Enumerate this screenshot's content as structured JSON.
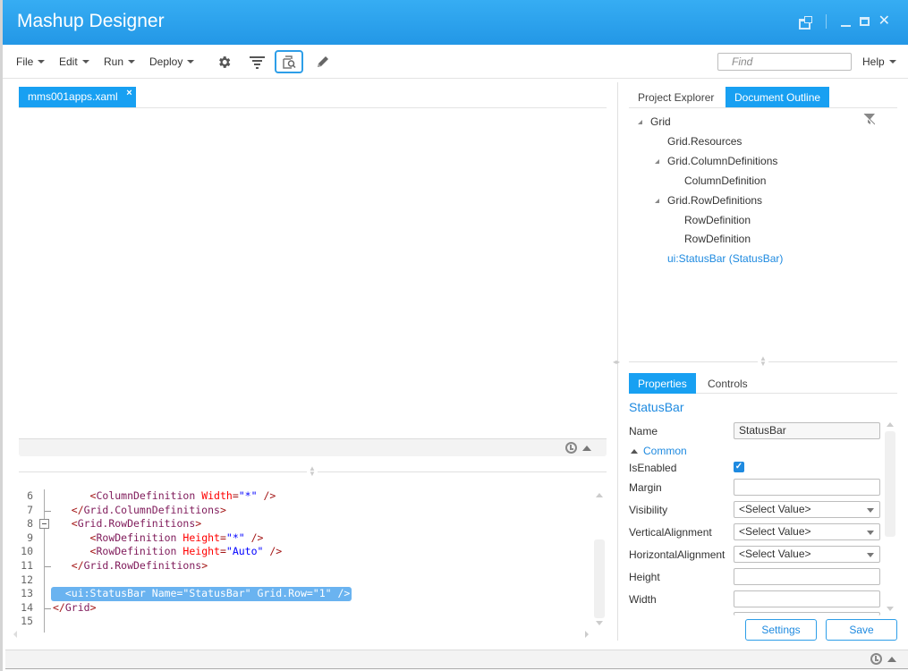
{
  "window": {
    "title": "Mashup Designer",
    "controls": [
      "restore-down",
      "minimize",
      "maximize",
      "close"
    ]
  },
  "toolbar": {
    "menus": [
      {
        "label": "File"
      },
      {
        "label": "Edit"
      },
      {
        "label": "Run"
      },
      {
        "label": "Deploy"
      }
    ],
    "tools": [
      {
        "icon": "gear-icon",
        "label": "Settings"
      },
      {
        "icon": "filter-icon",
        "label": "Filter"
      },
      {
        "icon": "preview-icon",
        "label": "Preview",
        "active": true
      },
      {
        "icon": "pencil-icon",
        "label": "Edit"
      }
    ],
    "find_placeholder": "Find",
    "help_label": "Help"
  },
  "editor": {
    "tabs": [
      {
        "label": "mms001apps.xaml",
        "close": "×"
      }
    ],
    "code_lines": [
      {
        "num": "6",
        "tokens": [
          {
            "t": "tag",
            "v": "      <"
          },
          {
            "t": "el",
            "v": "ColumnDefinition"
          },
          {
            "t": "",
            "v": " "
          },
          {
            "t": "attr",
            "v": "Width"
          },
          {
            "t": "tag",
            "v": "="
          },
          {
            "t": "val",
            "v": "\"*\""
          },
          {
            "t": "tag",
            "v": " />"
          }
        ]
      },
      {
        "num": "7",
        "tokens": [
          {
            "t": "tag",
            "v": "   </"
          },
          {
            "t": "el",
            "v": "Grid.ColumnDefinitions"
          },
          {
            "t": "tag",
            "v": ">"
          }
        ]
      },
      {
        "num": "8",
        "tokens": [
          {
            "t": "tag",
            "v": "   <"
          },
          {
            "t": "el",
            "v": "Grid.RowDefinitions"
          },
          {
            "t": "tag",
            "v": ">"
          }
        ]
      },
      {
        "num": "9",
        "tokens": [
          {
            "t": "tag",
            "v": "      <"
          },
          {
            "t": "el",
            "v": "RowDefinition"
          },
          {
            "t": "",
            "v": " "
          },
          {
            "t": "attr",
            "v": "Height"
          },
          {
            "t": "tag",
            "v": "="
          },
          {
            "t": "val",
            "v": "\"*\""
          },
          {
            "t": "tag",
            "v": " />"
          }
        ]
      },
      {
        "num": "10",
        "tokens": [
          {
            "t": "tag",
            "v": "      <"
          },
          {
            "t": "el",
            "v": "RowDefinition"
          },
          {
            "t": "",
            "v": " "
          },
          {
            "t": "attr",
            "v": "Height"
          },
          {
            "t": "tag",
            "v": "="
          },
          {
            "t": "val",
            "v": "\"Auto\""
          },
          {
            "t": "tag",
            "v": " />"
          }
        ]
      },
      {
        "num": "11",
        "tokens": [
          {
            "t": "tag",
            "v": "   </"
          },
          {
            "t": "el",
            "v": "Grid.RowDefinitions"
          },
          {
            "t": "tag",
            "v": ">"
          }
        ]
      },
      {
        "num": "12",
        "tokens": []
      },
      {
        "num": "13",
        "selected": true,
        "tokens": [
          {
            "t": "",
            "v": "  <ui:StatusBar Name=\"StatusBar\" Grid.Row=\"1\" />"
          }
        ]
      },
      {
        "num": "14",
        "tokens": [
          {
            "t": "tag",
            "v": "</"
          },
          {
            "t": "el",
            "v": "Grid"
          },
          {
            "t": "tag",
            "v": ">"
          }
        ]
      },
      {
        "num": "15",
        "tokens": []
      }
    ]
  },
  "right_panel": {
    "tabs": [
      {
        "label": "Project Explorer",
        "active": false
      },
      {
        "label": "Document Outline",
        "active": true
      }
    ],
    "outline": [
      {
        "label": "Grid",
        "level": 0,
        "expanded": true
      },
      {
        "label": "Grid.Resources",
        "level": 1
      },
      {
        "label": "Grid.ColumnDefinitions",
        "level": 1,
        "expanded": true
      },
      {
        "label": "ColumnDefinition",
        "level": 2
      },
      {
        "label": "Grid.RowDefinitions",
        "level": 1,
        "expanded": true
      },
      {
        "label": "RowDefinition",
        "level": 2
      },
      {
        "label": "RowDefinition",
        "level": 2
      },
      {
        "label": "ui:StatusBar (StatusBar)",
        "level": 1,
        "selected": true
      }
    ]
  },
  "properties": {
    "tabs": [
      {
        "label": "Properties",
        "active": true
      },
      {
        "label": "Controls",
        "active": false
      }
    ],
    "title": "StatusBar",
    "name_label": "Name",
    "name_value": "StatusBar",
    "section_label": "Common",
    "is_enabled_label": "IsEnabled",
    "is_enabled_checked": true,
    "rows": [
      {
        "label": "Margin",
        "type": "text",
        "value": ""
      },
      {
        "label": "Visibility",
        "type": "select",
        "value": "<Select Value>"
      },
      {
        "label": "VerticalAlignment",
        "type": "select",
        "value": "<Select Value>"
      },
      {
        "label": "HorizontalAlignment",
        "type": "select",
        "value": "<Select Value>"
      },
      {
        "label": "Height",
        "type": "text",
        "value": ""
      },
      {
        "label": "Width",
        "type": "text",
        "value": ""
      }
    ],
    "settings_label": "Settings",
    "save_label": "Save"
  },
  "colors": {
    "accent": "#18a0f2",
    "title_bar": "#2aa2ee",
    "link": "#1e8ae0"
  }
}
